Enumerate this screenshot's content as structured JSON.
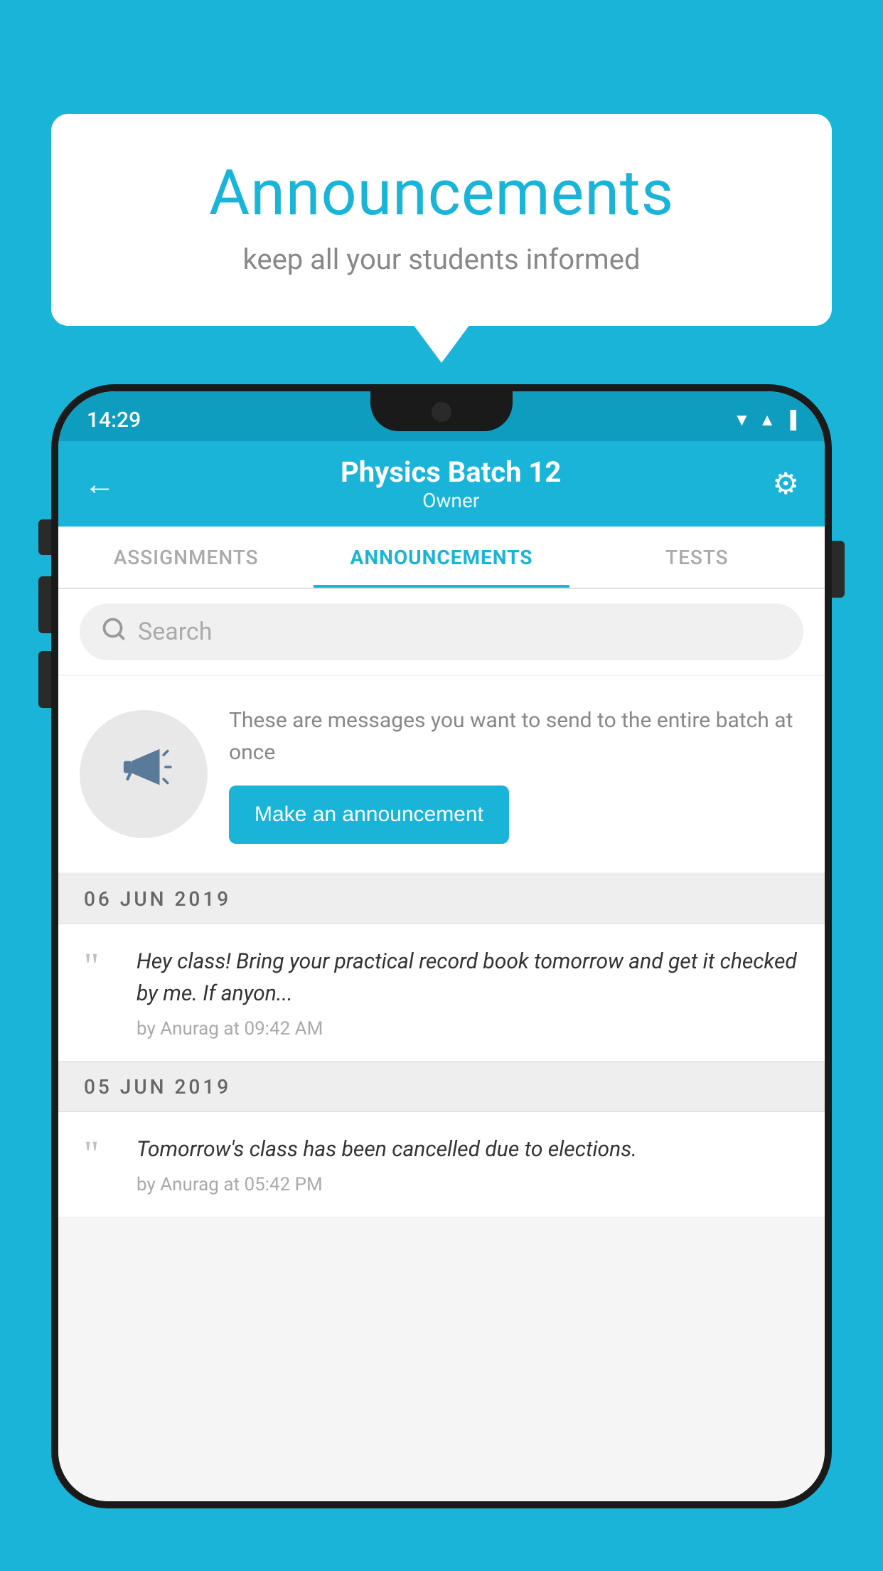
{
  "background_color": "#1ab4d8",
  "speech_bubble": {
    "title": "Announcements",
    "subtitle": "keep all your students informed"
  },
  "phone": {
    "status_bar": {
      "time": "14:29",
      "icons": [
        "wifi",
        "signal",
        "battery"
      ]
    },
    "app_bar": {
      "title": "Physics Batch 12",
      "subtitle": "Owner",
      "back_label": "←",
      "settings_label": "⚙"
    },
    "tabs": [
      {
        "label": "ASSIGNMENTS",
        "active": false
      },
      {
        "label": "ANNOUNCEMENTS",
        "active": true
      },
      {
        "label": "TESTS",
        "active": false
      }
    ],
    "search": {
      "placeholder": "Search"
    },
    "promo": {
      "description": "These are messages you want to send to the entire batch at once",
      "button_label": "Make an announcement"
    },
    "announcements": [
      {
        "date": "06  JUN  2019",
        "text": "Hey class! Bring your practical record book tomorrow and get it checked by me. If anyon...",
        "meta": "by Anurag at 09:42 AM"
      },
      {
        "date": "05  JUN  2019",
        "text": "Tomorrow's class has been cancelled due to elections.",
        "meta": "by Anurag at 05:42 PM"
      }
    ]
  }
}
